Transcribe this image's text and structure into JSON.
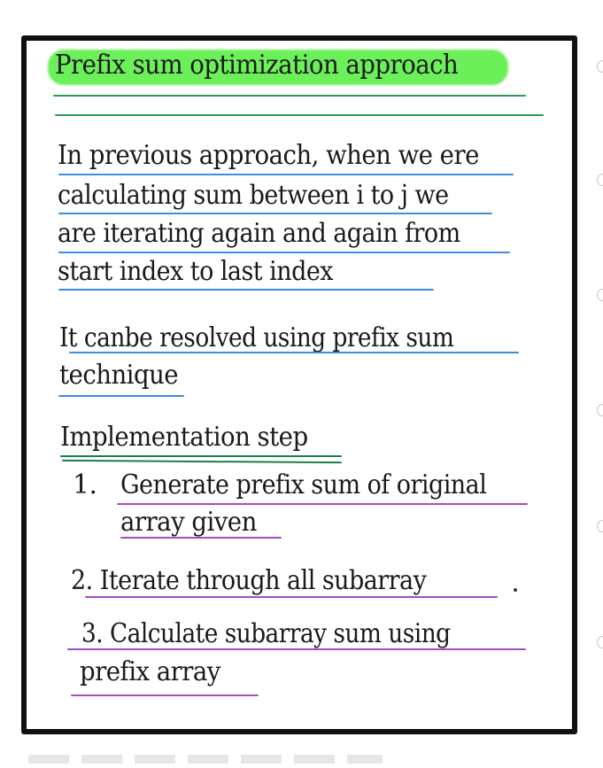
{
  "note": {
    "title": "Prefix sum optimization approach",
    "paragraph1": [
      "In previous approach, when we ere",
      "calculating sum between i to j we",
      "are iterating again and again from",
      "start index to last index"
    ],
    "paragraph2": [
      "It canbe resolved using prefix sum",
      "technique"
    ],
    "section_heading": "Implementation step",
    "steps": {
      "step1_number": "1.",
      "step1_lines": [
        "Generate prefix sum of original",
        "array given"
      ],
      "step2": "2. Iterate through all subarray",
      "step3_lines": [
        "3. Calculate subarray sum using",
        "prefix array"
      ]
    }
  },
  "colors": {
    "highlight": "#6cf05a",
    "title_underline": "#2f9a57",
    "paragraph_underline": "#3a8fe0",
    "step_underline": "#a24dc2",
    "ink": "#1a1a1a",
    "frame": "#111111"
  }
}
